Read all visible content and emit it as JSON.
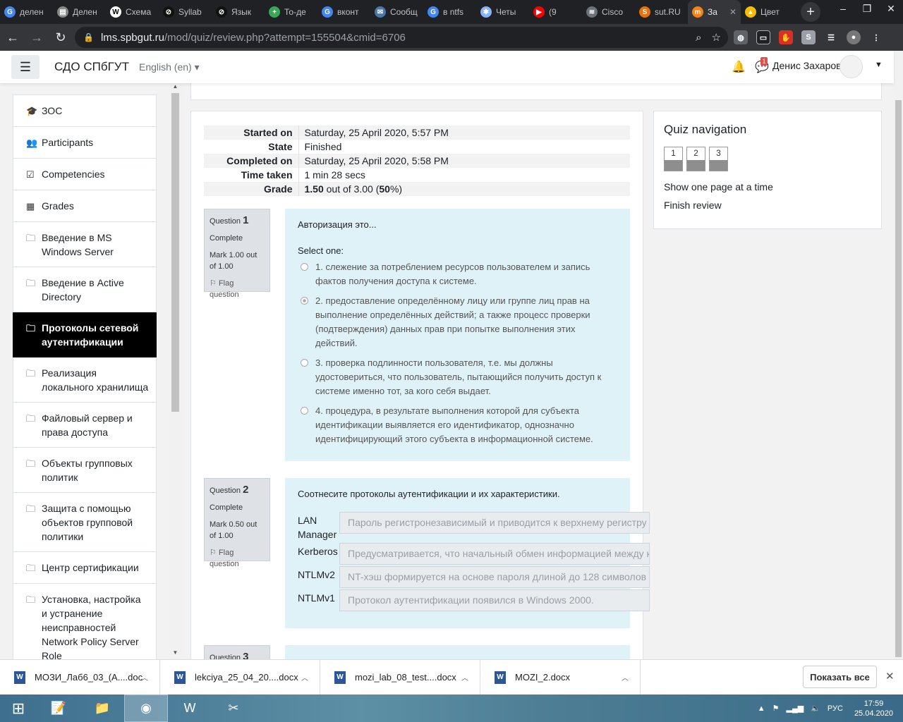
{
  "browser": {
    "tabs": [
      {
        "label": "делен",
        "icon": "google-icon",
        "color": "#4285f4",
        "glyph": "G"
      },
      {
        "label": "Делен",
        "icon": "doc-icon",
        "color": "#888888",
        "glyph": "▤"
      },
      {
        "label": "Схема",
        "icon": "wikipedia-icon",
        "color": "#ffffff",
        "glyph": "W"
      },
      {
        "label": "Syllab",
        "icon": "syllab-icon",
        "color": "#111111",
        "glyph": "⊘"
      },
      {
        "label": "Язык",
        "icon": "syllab-icon",
        "color": "#111111",
        "glyph": "⊘"
      },
      {
        "label": "То-де",
        "icon": "green-plus-icon",
        "color": "#3aa757",
        "glyph": "+"
      },
      {
        "label": "вконт",
        "icon": "google-icon",
        "color": "#4285f4",
        "glyph": "G"
      },
      {
        "label": "Сообщ",
        "icon": "chat-icon",
        "color": "#4a76a8",
        "glyph": "✉"
      },
      {
        "label": "в ntfs",
        "icon": "google-icon",
        "color": "#4285f4",
        "glyph": "G"
      },
      {
        "label": "Четы",
        "icon": "star-burst-icon",
        "color": "#8ab4f8",
        "glyph": "✱"
      },
      {
        "label": "(9",
        "icon": "youtube-icon",
        "color": "#ff0000",
        "glyph": "▶"
      },
      {
        "label": "Cisco",
        "icon": "cisco-icon",
        "color": "#6a737b",
        "glyph": "≋"
      },
      {
        "label": "sut.RU",
        "icon": "sut-icon",
        "color": "#e8710a",
        "glyph": "S"
      },
      {
        "label": "За",
        "icon": "moodle-icon",
        "color": "#f98012",
        "glyph": "m",
        "active": true
      },
      {
        "label": "Цвет",
        "icon": "drive-icon",
        "color": "#fbbc04",
        "glyph": "▲"
      }
    ],
    "url_host": "lms.spbgut.ru",
    "url_path": "/mod/quiz/review.php?attempt=155504&cmid=6706",
    "window_controls": [
      "–",
      "❐",
      "✕"
    ]
  },
  "header": {
    "site_name": "СДО СПбГУТ",
    "language": "English (en)",
    "message_count": "1",
    "user_name": "Денис Захаров"
  },
  "sidebar": {
    "items": [
      {
        "label": "ЗОС",
        "icon": "graduation-cap-icon",
        "glyph": "🎓"
      },
      {
        "label": "Participants",
        "icon": "users-icon",
        "glyph": "👥"
      },
      {
        "label": "Competencies",
        "icon": "checkbox-icon",
        "glyph": "☑"
      },
      {
        "label": "Grades",
        "icon": "table-icon",
        "glyph": "▦"
      },
      {
        "label": "Введение в MS Windows Server",
        "icon": "folder-icon",
        "glyph": "🗀"
      },
      {
        "label": "Введение в Active Directory",
        "icon": "folder-icon",
        "glyph": "🗀"
      },
      {
        "label": "Протоколы сетевой аутентификации",
        "icon": "folder-icon",
        "glyph": "🗀",
        "active": true
      },
      {
        "label": "Реализация локального хранилища",
        "icon": "folder-icon",
        "glyph": "🗀"
      },
      {
        "label": "Файловый сервер и права доступа",
        "icon": "folder-icon",
        "glyph": "🗀"
      },
      {
        "label": "Объекты групповых политик",
        "icon": "folder-icon",
        "glyph": "🗀"
      },
      {
        "label": "Защита с помощью объектов групповой политики",
        "icon": "folder-icon",
        "glyph": "🗀"
      },
      {
        "label": "Центр сертификации",
        "icon": "folder-icon",
        "glyph": "🗀"
      },
      {
        "label": "Установка, настройка и устранение неисправностей Network Policy Server Role",
        "icon": "folder-icon",
        "glyph": "🗀"
      }
    ]
  },
  "summary": {
    "rows": [
      {
        "label": "Started on",
        "value": "Saturday, 25 April 2020, 5:57 PM"
      },
      {
        "label": "State",
        "value": "Finished"
      },
      {
        "label": "Completed on",
        "value": "Saturday, 25 April 2020, 5:58 PM"
      },
      {
        "label": "Time taken",
        "value": "1 min 28 secs"
      }
    ],
    "grade_label": "Grade",
    "grade_value": "1.50",
    "grade_outof": " out of 3.00 (",
    "grade_pct": "50",
    "grade_end": "%)"
  },
  "q1": {
    "qword": "Question",
    "number": "1",
    "status": "Complete",
    "mark": "Mark 1.00 out of 1.00",
    "flag": "Flag question",
    "text": "Авторизация это...",
    "select_one": "Select one:",
    "options": [
      "1. слежение за потреблением ресурсов пользователем и запись фактов получения доступа к системе.",
      "2. предоставление определённому лицу или группе лиц прав на выполнение определённых действий; а также процесс проверки (подтверждения) данных прав при попытке выполнения этих действий.",
      "3. проверка подлинности пользователя, т.е. мы должны удостовериться, что пользователь, пытающийся получить доступ к системе именно тот, за кого себя выдает.",
      "4. процедура, в результате выполнения которой для субъекта идентификации выявляется его идентификатор, однозначно идентифицирующий этого субъекта в информационной системе."
    ],
    "selected": 1
  },
  "q2": {
    "qword": "Question",
    "number": "2",
    "status": "Complete",
    "mark": "Mark 0.50 out of 1.00",
    "flag": "Flag question",
    "text": "Соотнесите протоколы аутентификации и их характеристики.",
    "rows": [
      {
        "label": "LAN Manager",
        "value": "Пароль регистронезависимый и приводится к верхнему регистру"
      },
      {
        "label": "Kerberos",
        "value": "Предусматривается, что начальный обмен информацией между кл"
      },
      {
        "label": "NTLMv2",
        "value": "NT-хэш формируется на основе пароля длиной до 128 символов по"
      },
      {
        "label": "NTLMv1",
        "value": "Протокол аутентификации появился в Windows 2000."
      }
    ]
  },
  "q3": {
    "qword": "Question",
    "number": "3"
  },
  "quiz_nav": {
    "title": "Quiz navigation",
    "buttons": [
      "1",
      "2",
      "3"
    ],
    "show_one_page": "Show one page at a time",
    "finish_review": "Finish review"
  },
  "downloads": {
    "items": [
      "МОЗИ_Лаб6_03_(А....doc",
      "lekciya_25_04_20....docx",
      "mozi_lab_08_test....docx",
      "MOZI_2.docx"
    ],
    "show_all": "Показать все"
  },
  "taskbar": {
    "apps": [
      {
        "name": "notepad-icon",
        "glyph": "📝"
      },
      {
        "name": "file-explorer-icon",
        "glyph": "📁"
      },
      {
        "name": "chrome-icon",
        "glyph": "◉",
        "active": true
      },
      {
        "name": "word-icon",
        "glyph": "W"
      },
      {
        "name": "snipping-tool-icon",
        "glyph": "✂"
      }
    ],
    "language": "РУС",
    "time": "17:59",
    "date": "25.04.2020"
  }
}
